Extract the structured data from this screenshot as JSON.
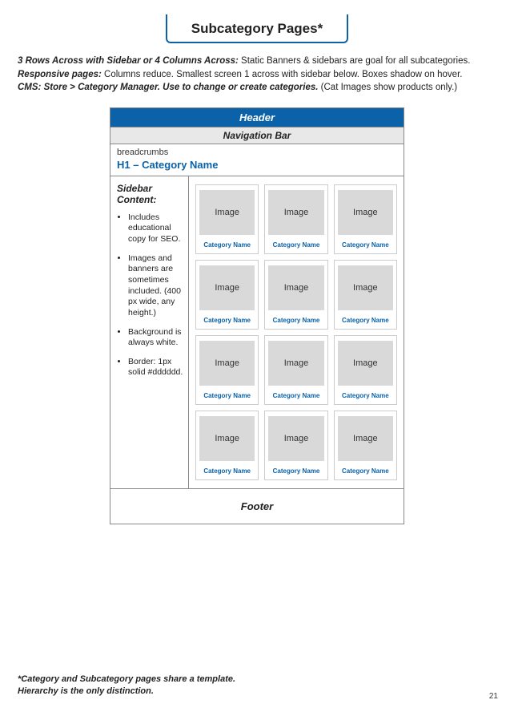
{
  "title": "Subcategory Pages*",
  "desc": {
    "line1_lead": "3 Rows Across with Sidebar or 4 Columns Across:",
    "line1_rest": " Static Banners & sidebars are goal for all subcategories.",
    "line2_lead": "Responsive pages:",
    "line2_rest": " Columns reduce. Smallest screen 1 across with sidebar below. Boxes shadow on hover.",
    "line3_lead": "CMS: Store > Category Manager. Use to change or create categories.",
    "line3_rest": " (Cat Images show products only.)"
  },
  "frame": {
    "header": "Header",
    "nav": "Navigation Bar",
    "breadcrumbs": "breadcrumbs",
    "h1": "H1 – Category Name",
    "sidebar_title": "Sidebar Content:",
    "sidebar_items": [
      "Includes educational copy for SEO.",
      "Images and banners are sometimes included. (400 px wide, any height.)",
      "Background is always white.",
      "Border: 1px solid #dddddd."
    ],
    "image_label": "Image",
    "cat_label": "Category Name",
    "footer": "Footer"
  },
  "footnote_line1": "*Category and Subcategory pages share a template.",
  "footnote_line2": "  Hierarchy is the only distinction.",
  "page_number": "21"
}
